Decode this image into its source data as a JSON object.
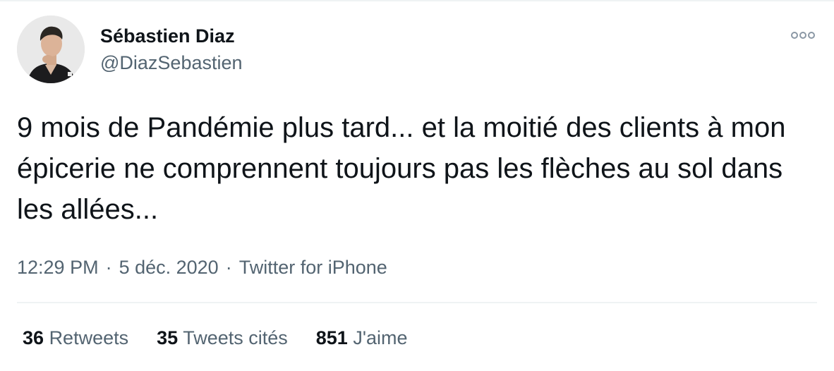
{
  "author": {
    "display_name": "Sébastien Diaz",
    "handle": "@DiazSebastien"
  },
  "tweet": {
    "text": "9 mois de Pandémie plus tard... et la moitié des clients à mon épicerie ne comprennent toujours pas les flèches au sol dans les allées..."
  },
  "meta": {
    "time": "12:29 PM",
    "separator": "·",
    "date": "5 déc. 2020",
    "source": "Twitter for iPhone"
  },
  "stats": [
    {
      "count": "36",
      "label": "Retweets"
    },
    {
      "count": "35",
      "label": "Tweets cités"
    },
    {
      "count": "851",
      "label": "J'aime"
    }
  ],
  "icons": {
    "more": "more-options-icon",
    "avatar": "avatar-photo"
  },
  "colors": {
    "primary_text": "#0f1419",
    "secondary_text": "#536471",
    "divider": "#eff3f4"
  }
}
